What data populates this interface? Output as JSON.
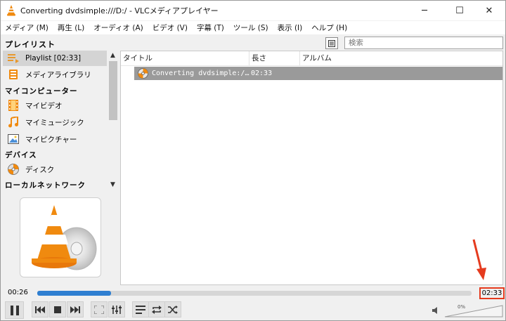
{
  "window": {
    "title": "Converting dvdsimple:///D:/ - VLCメディアプレイヤー",
    "min_glyph": "─",
    "max_glyph": "☐",
    "close_glyph": "✕"
  },
  "menu": [
    "メディア (M)",
    "再生 (L)",
    "オーディオ (A)",
    "ビデオ (V)",
    "字幕 (T)",
    "ツール (S)",
    "表示 (I)",
    "ヘルプ (H)"
  ],
  "playlist_header": {
    "label": "プレイリスト",
    "search_placeholder": "検索"
  },
  "sidebar": {
    "playlist_item": "Playlist [02:33]",
    "media_library": "メディアライブラリ",
    "my_computer_head": "マイコンピューター",
    "my_videos": "マイビデオ",
    "my_music": "マイミュージック",
    "my_pictures": "マイピクチャー",
    "devices_head": "デバイス",
    "disc": "ディスク",
    "local_network_head": "ローカルネットワーク"
  },
  "playlist_table": {
    "columns": [
      "タイトル",
      "長さ",
      "アルバム"
    ],
    "rows": [
      {
        "title": "Converting dvdsimple:/…",
        "length": "02:33",
        "album": ""
      }
    ]
  },
  "seek": {
    "elapsed": "00:26",
    "total": "02:33",
    "progress": 0.17
  },
  "volume": {
    "percent_label": "0%",
    "level": 0.0
  },
  "colors": {
    "accent": "#2f7fd1",
    "highlight": "#e53b1e",
    "vlc_orange": "#f08a0f",
    "selected_row": "#9a9a9a"
  },
  "icons": {
    "app": "vlc-cone-icon",
    "view_mode": "playlist-view-icon",
    "playlist": "playlist-icon",
    "media_library": "library-icon",
    "videos": "film-icon",
    "music": "music-note-icon",
    "pictures": "picture-icon",
    "disc": "disc-icon",
    "volume": "speaker-icon"
  }
}
